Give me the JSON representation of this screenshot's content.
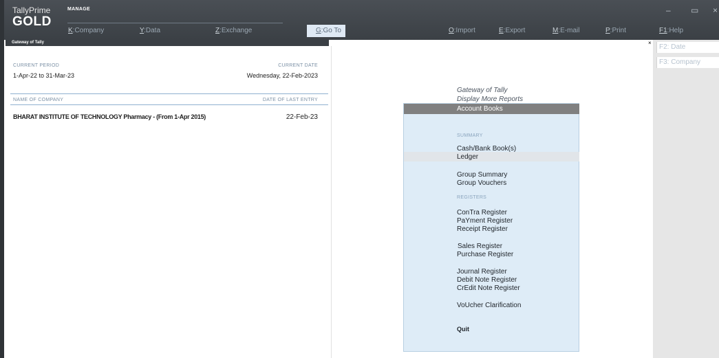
{
  "brand": {
    "product": "TallyPrime",
    "edition": "GOLD"
  },
  "top": {
    "manage": "MANAGE",
    "menu": [
      {
        "key": "K",
        "label": ":Company"
      },
      {
        "key": "Y",
        "label": ":Data"
      },
      {
        "key": "Z",
        "label": ":Exchange"
      }
    ],
    "goto": {
      "key": "G",
      "label": ":Go To"
    },
    "actions": [
      {
        "key": "O",
        "label": ":Import"
      },
      {
        "key": "E",
        "label": ":Export"
      },
      {
        "key": "M",
        "label": ":E-mail"
      },
      {
        "key": "P",
        "label": ":Print"
      },
      {
        "key": "F1",
        "label": ":Help"
      }
    ],
    "window": {
      "minimize": "–",
      "maximize": "▭",
      "close": "×"
    }
  },
  "gateway_strip": "Gateway of Tally",
  "left": {
    "current_period_label": "CURRENT PERIOD",
    "current_period": "1-Apr-22 to 31-Mar-23",
    "current_date_label": "CURRENT DATE",
    "current_date": "Wednesday, 22-Feb-2023",
    "name_of_company_label": "NAME OF COMPANY",
    "date_of_last_entry_label": "DATE OF LAST ENTRY",
    "company_name": "BHARAT INSTITUTE OF TECHNOLOGY Pharmacy - (From 1-Apr 2015)",
    "last_entry": "22-Feb-23"
  },
  "right_panel": {
    "close": "×",
    "items": [
      "F2: Date",
      "F3: Company"
    ]
  },
  "menu": {
    "breadcrumb1": "Gateway of Tally",
    "breadcrumb2": "Display More Reports",
    "title": "Account Books",
    "summary_label": "SUMMARY",
    "summary_items": [
      "Cash/Bank Book(s)",
      "Ledger",
      "Group Summary",
      "Group Vouchers"
    ],
    "registers_label": "REGISTERS",
    "register_items": [
      "ConTra Register",
      "PaYment Register",
      "Receipt Register",
      "Sales Register",
      "Purchase Register",
      "Journal Register",
      "Debit Note Register",
      "CrEdit Note Register",
      "VoUcher Clarification"
    ],
    "quit": "Quit"
  }
}
